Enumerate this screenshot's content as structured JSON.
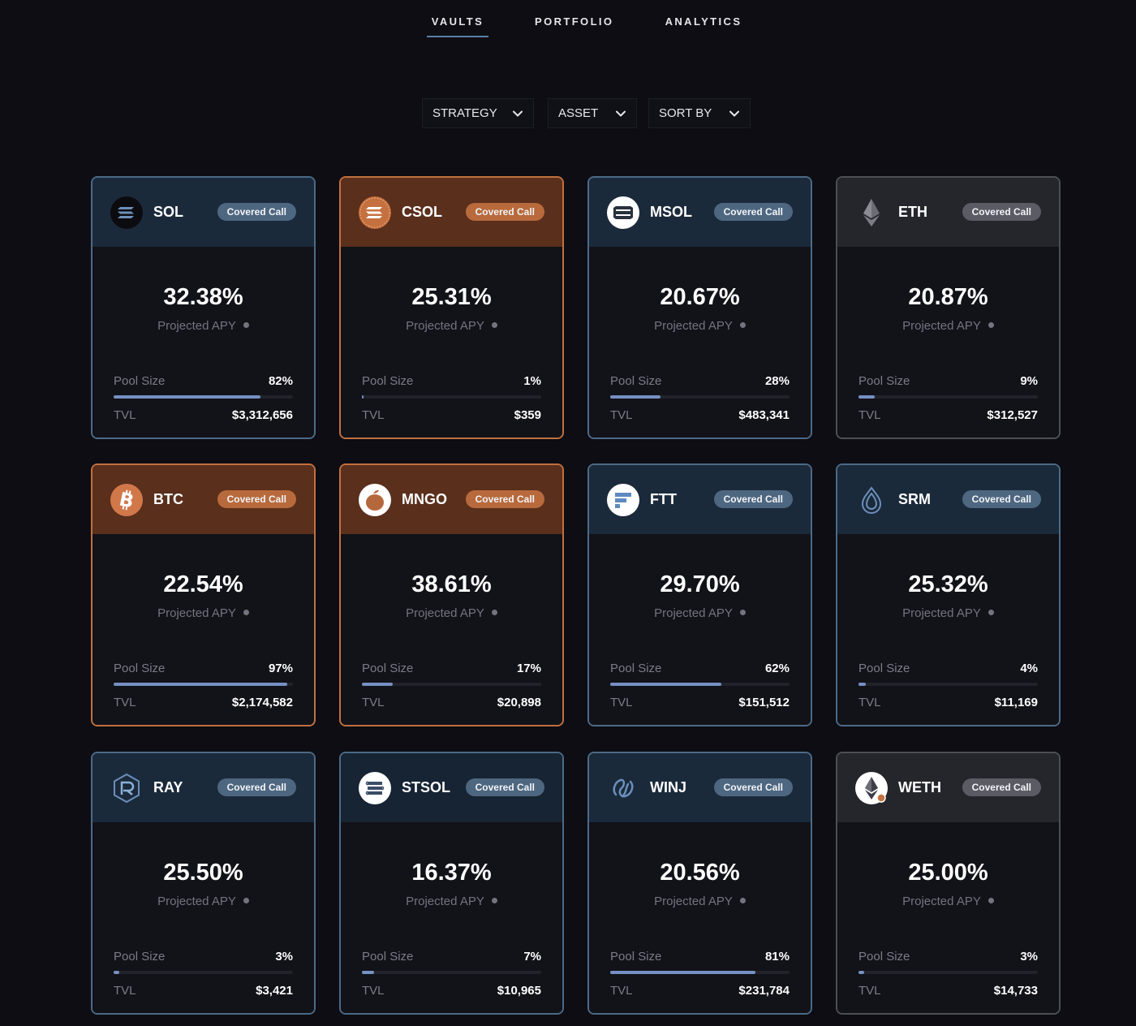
{
  "nav": {
    "tabs": [
      {
        "label": "VAULTS",
        "active": true
      },
      {
        "label": "PORTFOLIO",
        "active": false
      },
      {
        "label": "ANALYTICS",
        "active": false
      }
    ]
  },
  "filters": [
    {
      "label": "STRATEGY",
      "icon": "chevron-down-icon"
    },
    {
      "label": "ASSET",
      "icon": "chevron-down-icon"
    },
    {
      "label": "SORT BY",
      "icon": "chevron-down-icon"
    }
  ],
  "labels": {
    "projected_apy": "Projected APY",
    "pool_size": "Pool Size",
    "tvl": "TVL"
  },
  "colors": {
    "blue_border": "#4c6a86",
    "orange_border": "#c1703f",
    "gray_border": "#4d4e56",
    "pool_fill": "#7590c2"
  },
  "vaults": [
    {
      "token": "SOL",
      "strategy": "Covered Call",
      "apy": "32.38%",
      "pool_size": "82%",
      "pool_fraction": 0.82,
      "tvl": "$3,312,656",
      "theme": "blue",
      "icon": "sol-icon"
    },
    {
      "token": "CSOL",
      "strategy": "Covered Call",
      "apy": "25.31%",
      "pool_size": "1%",
      "pool_fraction": 0.01,
      "tvl": "$359",
      "theme": "orange",
      "icon": "csol-icon"
    },
    {
      "token": "MSOL",
      "strategy": "Covered Call",
      "apy": "20.67%",
      "pool_size": "28%",
      "pool_fraction": 0.28,
      "tvl": "$483,341",
      "theme": "blue",
      "icon": "msol-icon"
    },
    {
      "token": "ETH",
      "strategy": "Covered Call",
      "apy": "20.87%",
      "pool_size": "9%",
      "pool_fraction": 0.09,
      "tvl": "$312,527",
      "theme": "gray",
      "icon": "eth-icon"
    },
    {
      "token": "BTC",
      "strategy": "Covered Call",
      "apy": "22.54%",
      "pool_size": "97%",
      "pool_fraction": 0.97,
      "tvl": "$2,174,582",
      "theme": "orange",
      "icon": "btc-icon"
    },
    {
      "token": "MNGO",
      "strategy": "Covered Call",
      "apy": "38.61%",
      "pool_size": "17%",
      "pool_fraction": 0.17,
      "tvl": "$20,898",
      "theme": "orange",
      "icon": "mngo-icon"
    },
    {
      "token": "FTT",
      "strategy": "Covered Call",
      "apy": "29.70%",
      "pool_size": "62%",
      "pool_fraction": 0.62,
      "tvl": "$151,512",
      "theme": "blue",
      "icon": "ftt-icon"
    },
    {
      "token": "SRM",
      "strategy": "Covered Call",
      "apy": "25.32%",
      "pool_size": "4%",
      "pool_fraction": 0.04,
      "tvl": "$11,169",
      "theme": "blue",
      "icon": "srm-icon"
    },
    {
      "token": "RAY",
      "strategy": "Covered Call",
      "apy": "25.50%",
      "pool_size": "3%",
      "pool_fraction": 0.03,
      "tvl": "$3,421",
      "theme": "blue",
      "icon": "ray-icon"
    },
    {
      "token": "STSOL",
      "strategy": "Covered Call",
      "apy": "16.37%",
      "pool_size": "7%",
      "pool_fraction": 0.07,
      "tvl": "$10,965",
      "theme": "mist",
      "icon": "stsol-icon"
    },
    {
      "token": "WINJ",
      "strategy": "Covered Call",
      "apy": "20.56%",
      "pool_size": "81%",
      "pool_fraction": 0.81,
      "tvl": "$231,784",
      "theme": "blue",
      "icon": "winj-icon"
    },
    {
      "token": "WETH",
      "strategy": "Covered Call",
      "apy": "25.00%",
      "pool_size": "3%",
      "pool_fraction": 0.03,
      "tvl": "$14,733",
      "theme": "gray",
      "icon": "weth-icon"
    }
  ]
}
